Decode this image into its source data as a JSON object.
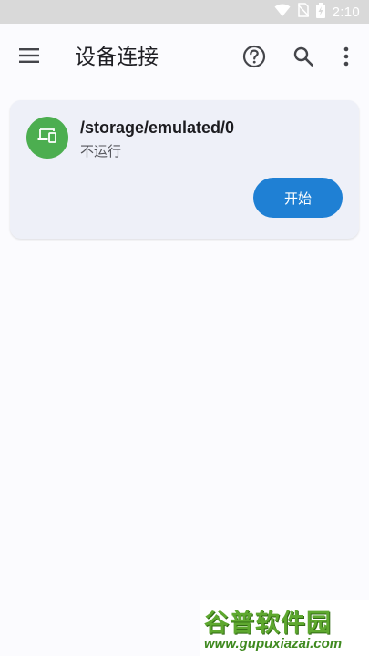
{
  "status_bar": {
    "time": "2:10",
    "icons": [
      "wifi-icon",
      "no-sim-icon",
      "battery-charging-icon"
    ]
  },
  "app_bar": {
    "title": "设备连接",
    "menu_icon": "hamburger-menu-icon",
    "actions": [
      "help-icon",
      "search-icon",
      "more-vert-icon"
    ]
  },
  "device_card": {
    "icon": "devices-icon",
    "icon_bg": "#4cae50",
    "path": "/storage/emulated/0",
    "status": "不运行",
    "start_label": "开始",
    "start_color": "#1f80d4"
  },
  "watermark": {
    "title": "谷普软件园",
    "url": "www.gupuxiazai.com"
  }
}
